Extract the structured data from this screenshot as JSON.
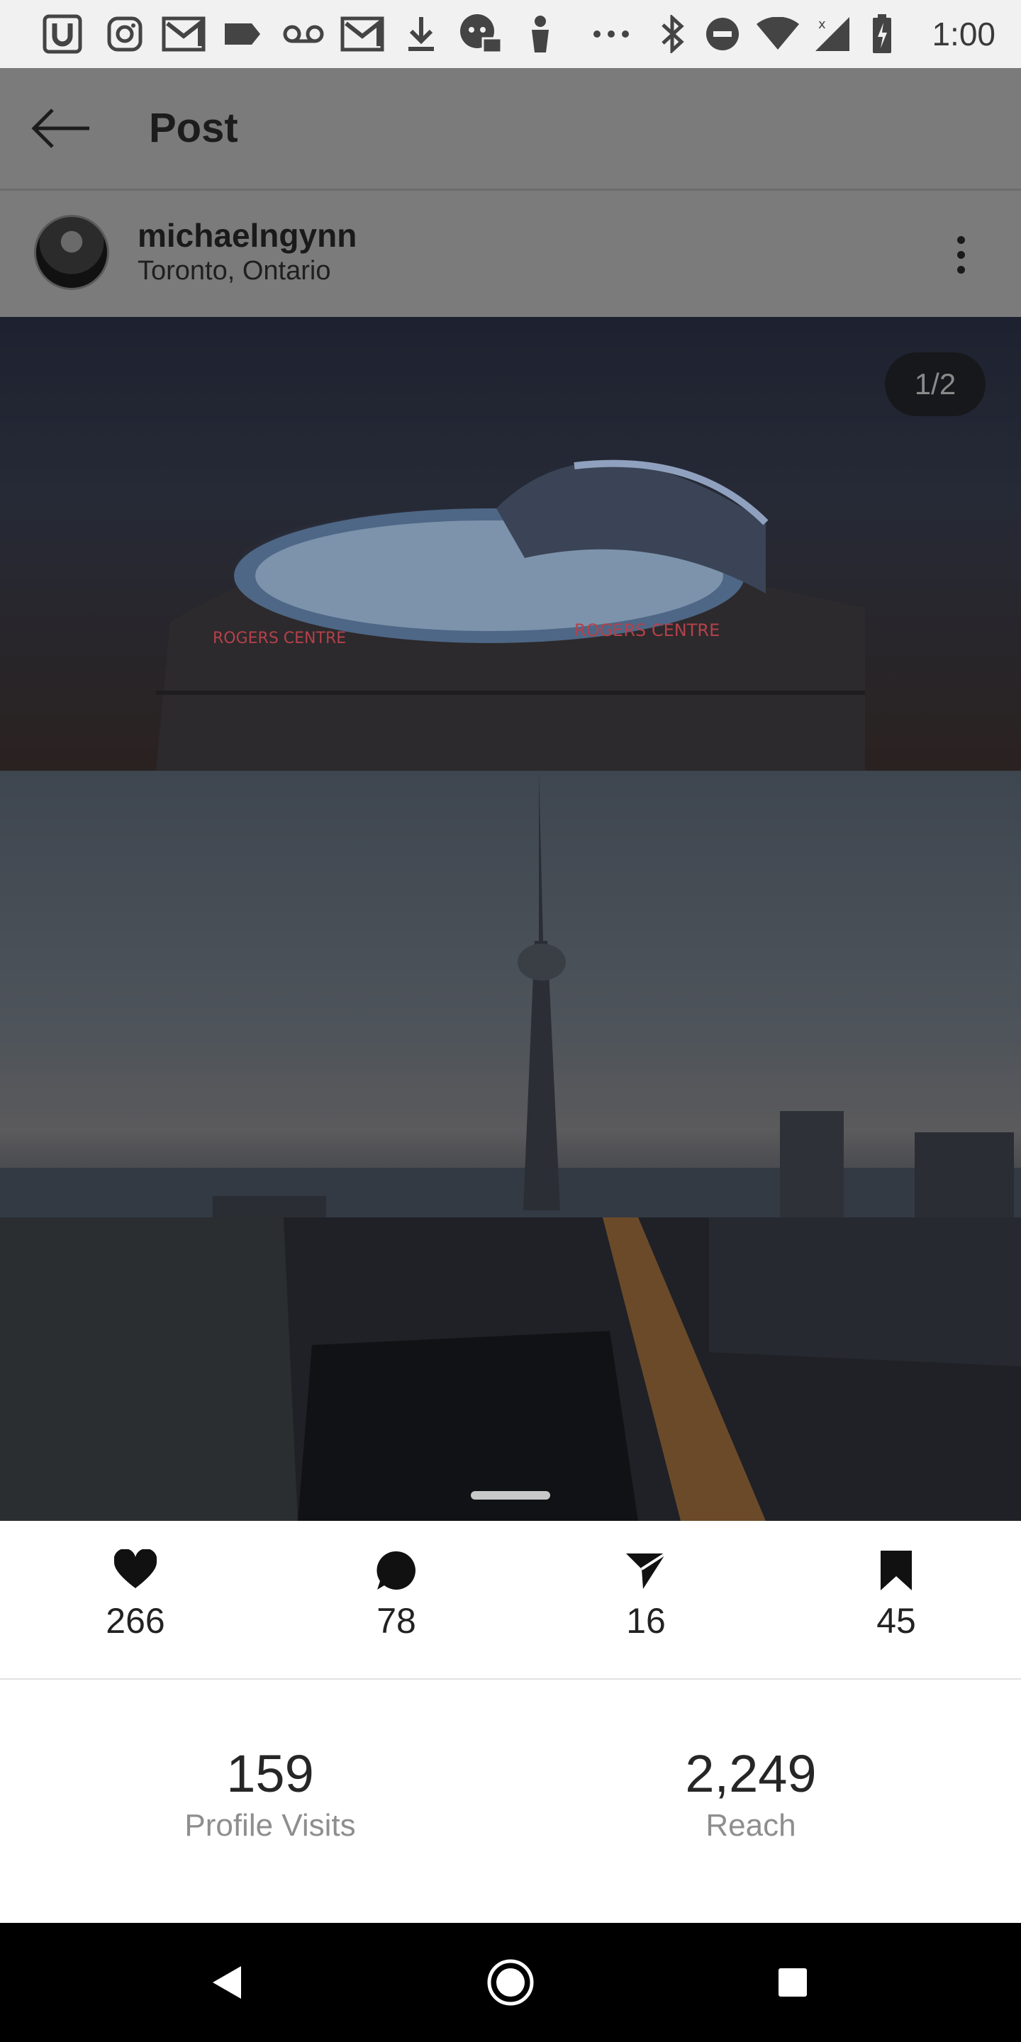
{
  "status_bar": {
    "time": "1:00",
    "left_icons": [
      "u-app-icon",
      "instagram-icon",
      "gmail-icon",
      "label-icon",
      "voicemail-icon",
      "gmail-icon",
      "download-icon",
      "chat-bubble-icon",
      "person-icon",
      "more-horiz-icon"
    ],
    "right_icons": [
      "bluetooth-icon",
      "do-not-disturb-icon",
      "wifi-icon",
      "cell-signal-icon",
      "battery-charging-icon"
    ]
  },
  "header": {
    "title": "Post",
    "back_icon": "arrow-back-icon"
  },
  "author": {
    "username": "michaelngynn",
    "location": "Toronto, Ontario",
    "more_icon": "more-vert-icon"
  },
  "media": {
    "counter": "1/2",
    "stadium_sign_left": "ROGERS CENTRE",
    "stadium_sign_right": "ROGERS CENTRE"
  },
  "stats": {
    "likes": "266",
    "comments": "78",
    "shares": "16",
    "saves": "45",
    "icons": [
      "heart-icon",
      "comment-icon",
      "send-icon",
      "bookmark-icon"
    ]
  },
  "insights": {
    "profile_visits_value": "159",
    "profile_visits_label": "Profile Visits",
    "reach_value": "2,249",
    "reach_label": "Reach"
  },
  "nav": {
    "icons": [
      "nav-back-icon",
      "nav-home-icon",
      "nav-recents-icon"
    ]
  },
  "colors": {
    "overlay_gray": "#7b7b7b",
    "text_dark": "#222222",
    "text_muted": "#8e8e8e",
    "nav_black": "#000000"
  }
}
